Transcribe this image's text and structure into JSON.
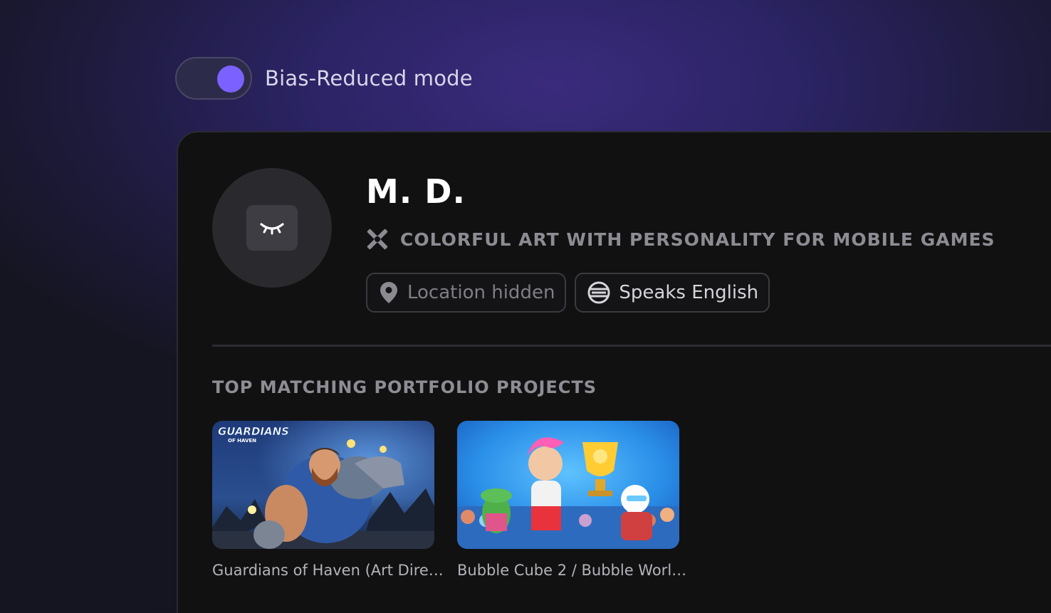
{
  "toggle": {
    "label": "Bias-Reduced mode",
    "state": "on",
    "accent": "#7b61ff"
  },
  "profile": {
    "avatar_icon": "closed-eye-icon",
    "name": "M. D.",
    "tagline_icon": "tools-cross-icon",
    "tagline": "COLORFUL ART WITH PERSONALITY FOR MOBILE GAMES",
    "chips": [
      {
        "icon": "location-pin-icon",
        "label": "Location hidden"
      },
      {
        "icon": "language-globe-icon",
        "label": "Speaks English"
      }
    ]
  },
  "portfolio": {
    "section_title": "TOP MATCHING PORTFOLIO PROJECTS",
    "projects": [
      {
        "title": "Guardians of Haven (Art Dire…",
        "thumb_logo": "GUARDIANS",
        "thumb_logo_sub": "OF HAVEN"
      },
      {
        "title": "Bubble Cube 2 / Bubble Worl…"
      }
    ]
  }
}
